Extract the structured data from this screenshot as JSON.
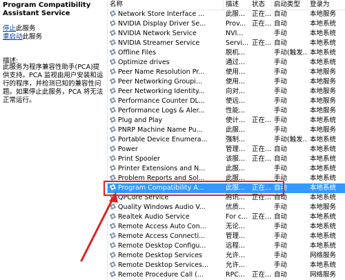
{
  "left": {
    "service_title": "Program Compatibility Assistant Service",
    "stop_link": "停止",
    "stop_suffix": "此服务",
    "restart_link": "重启动",
    "restart_suffix": "此服务",
    "desc_label": "描述:",
    "description": "此服务为程序兼容性助手(PCA)提供支持。PCA 监视由用户安装和运行的程序，并检测已知的兼容性问题。如果停止此服务，PCA 将无法正常运行。"
  },
  "columns": {
    "name": "名称",
    "desc": "描述",
    "status": "状态",
    "start": "启动类型",
    "logon": "登录为"
  },
  "rows": [
    {
      "name": "Network Store Interface ...",
      "desc": "此服...",
      "status": "正在...",
      "start": "自动",
      "logon": "本地服务"
    },
    {
      "name": "NVIDIA Display Driver Se...",
      "desc": "Prov...",
      "status": "正在...",
      "start": "自动",
      "logon": "本地系统"
    },
    {
      "name": "NVIDIA Network Service",
      "desc": "NVI...",
      "status": "",
      "start": "手动",
      "logon": "本地系统"
    },
    {
      "name": "NVIDIA Streamer Service",
      "desc": "Servi...",
      "status": "正在...",
      "start": "自动",
      "logon": "本地系统"
    },
    {
      "name": "Offline Files",
      "desc": "脱机...",
      "status": "",
      "start": "手动(触发...",
      "logon": "本地系统"
    },
    {
      "name": "Optimize drives",
      "desc": "通过...",
      "status": "",
      "start": "手动",
      "logon": "本地系统"
    },
    {
      "name": "Peer Name Resolution Pr...",
      "desc": "使用...",
      "status": "",
      "start": "手动",
      "logon": "本地服务"
    },
    {
      "name": "Peer Networking Groupi...",
      "desc": "使用...",
      "status": "",
      "start": "手动",
      "logon": "本地服务"
    },
    {
      "name": "Peer Networking Identity...",
      "desc": "向对...",
      "status": "",
      "start": "手动",
      "logon": "本地服务"
    },
    {
      "name": "Performance Counter DL...",
      "desc": "使远...",
      "status": "",
      "start": "手动",
      "logon": "本地服务"
    },
    {
      "name": "Performance Logs & Aler...",
      "desc": "性能...",
      "status": "",
      "start": "手动",
      "logon": "本地服务"
    },
    {
      "name": "Plug and Play",
      "desc": "使计...",
      "status": "正在...",
      "start": "手动",
      "logon": "本地系统"
    },
    {
      "name": "PNRP Machine Name Pu...",
      "desc": "此服...",
      "status": "",
      "start": "手动",
      "logon": "本地服务"
    },
    {
      "name": "Portable Device Enumera...",
      "desc": "强制...",
      "status": "",
      "start": "手动(触发...",
      "logon": "本地系统"
    },
    {
      "name": "Power",
      "desc": "管理...",
      "status": "正在...",
      "start": "自动",
      "logon": "本地系统"
    },
    {
      "name": "Print Spooler",
      "desc": "该服...",
      "status": "正在...",
      "start": "自动",
      "logon": "本地系统"
    },
    {
      "name": "Printer Extensions and N...",
      "desc": "此服...",
      "status": "",
      "start": "手动",
      "logon": "本地系统"
    },
    {
      "name": "Problem Reports and Sol...",
      "desc": "此服...",
      "status": "",
      "start": "手动",
      "logon": "本地系统"
    },
    {
      "name": "Program Compatibility A...",
      "desc": "此服...",
      "status": "正在...",
      "start": "自动",
      "logon": "本地系统",
      "selected": true
    },
    {
      "name": "QPCore Service",
      "desc": "腾讯...",
      "status": "正在...",
      "start": "自动",
      "logon": "本地系统"
    },
    {
      "name": "Quality Windows Audio V...",
      "desc": "优质...",
      "status": "",
      "start": "手动",
      "logon": "本地服务"
    },
    {
      "name": "Realtek Audio Service",
      "desc": "For c...",
      "status": "正在...",
      "start": "自动",
      "logon": "本地系统"
    },
    {
      "name": "Remote Access Auto Con...",
      "desc": "无论...",
      "status": "",
      "start": "手动",
      "logon": "本地系统"
    },
    {
      "name": "Remote Access Connecti...",
      "desc": "管理...",
      "status": "",
      "start": "手动",
      "logon": "本地系统"
    },
    {
      "name": "Remote Desktop Configu...",
      "desc": "远程...",
      "status": "",
      "start": "手动",
      "logon": "本地系统"
    },
    {
      "name": "Remote Desktop Services",
      "desc": "允许...",
      "status": "",
      "start": "手动",
      "logon": "网络服务"
    },
    {
      "name": "Remote Desktop Services...",
      "desc": "允许...",
      "status": "",
      "start": "手动",
      "logon": "本地系统"
    },
    {
      "name": "Remote Procedure Call (...",
      "desc": "RPC...",
      "status": "正在...",
      "start": "自动",
      "logon": "网络服务"
    }
  ],
  "colors": {
    "selected_bg": "#3399ff",
    "highlight": "#e02020",
    "arrow": "#e02020"
  }
}
